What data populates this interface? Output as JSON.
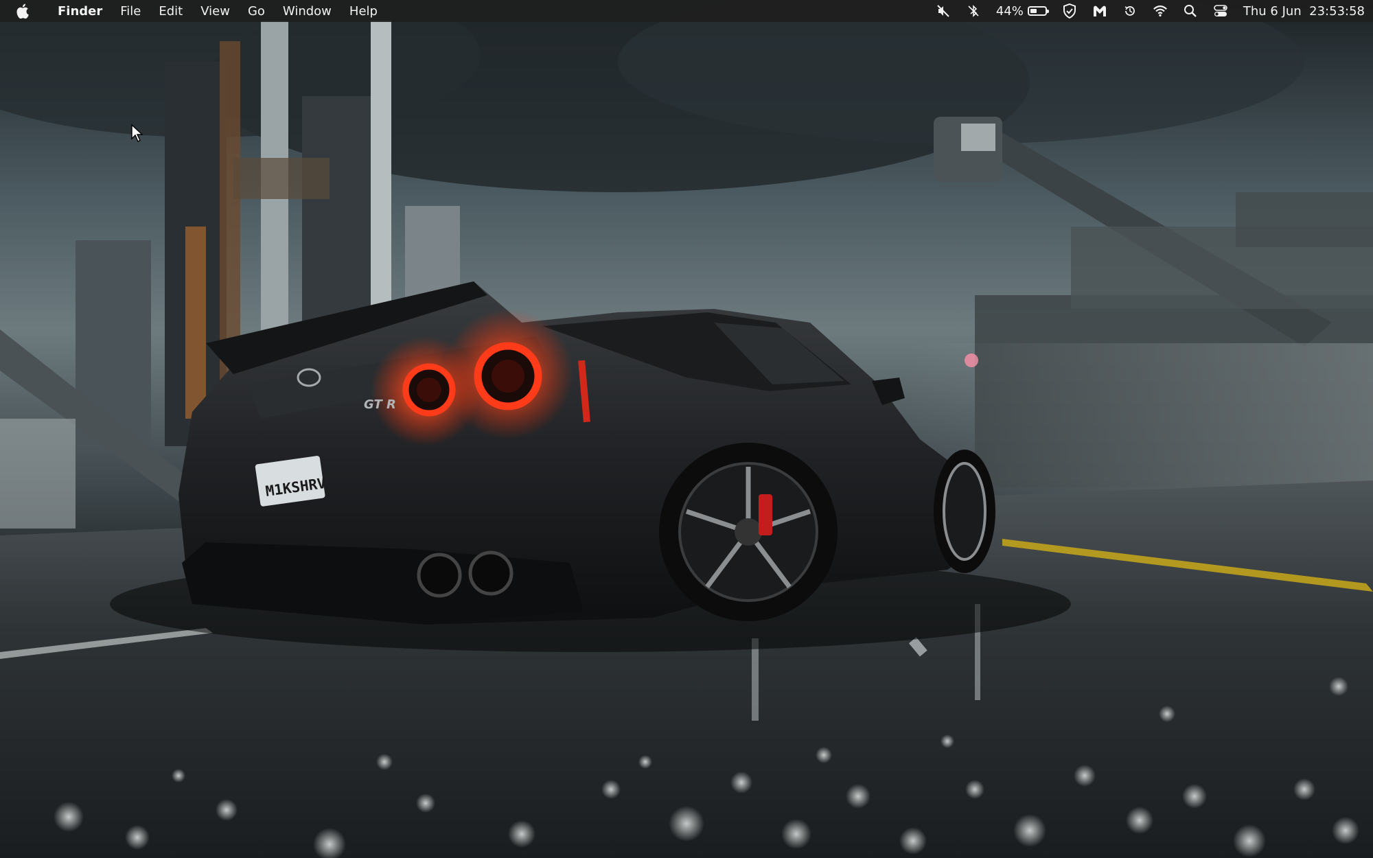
{
  "menubar": {
    "apple_icon": "apple-logo-icon",
    "app_name": "Finder",
    "menus": [
      "File",
      "Edit",
      "View",
      "Go",
      "Window",
      "Help"
    ],
    "status": {
      "battery_percent": "44%",
      "battery_level": 0.44,
      "datetime": "Thu 6 Jun  23:53:58"
    }
  },
  "wallpaper": {
    "license_plate": "M1KSHRV",
    "badge": "GT R"
  },
  "colors": {
    "menubar_bg": "#1e1e1e",
    "tail_light": "#ff3b1a",
    "road_line": "#c9a81a"
  }
}
